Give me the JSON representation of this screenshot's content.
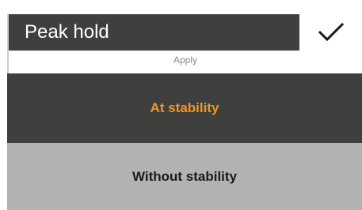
{
  "header": {
    "title": "Peak hold",
    "confirm_icon": "checkmark-icon"
  },
  "apply_label": "Apply",
  "options": [
    {
      "label": "At stability",
      "selected": true
    },
    {
      "label": "Without stability",
      "selected": false
    }
  ],
  "colors": {
    "header_bg": "#3f3f3d",
    "selected_bg": "#3f3f3d",
    "selected_text": "#ef9628",
    "unselected_bg": "#b2b2b2",
    "unselected_text": "#1a1a1a"
  }
}
